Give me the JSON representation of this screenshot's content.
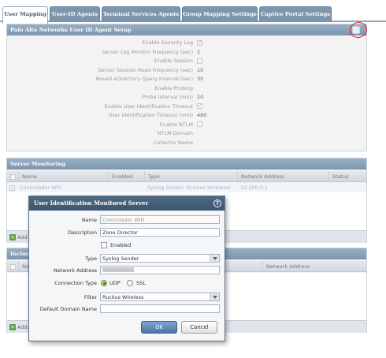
{
  "tabs": [
    {
      "label": "User Mapping"
    },
    {
      "label": "User-ID Agents"
    },
    {
      "label": "Terminal Services Agents"
    },
    {
      "label": "Group Mapping Settings"
    },
    {
      "label": "Captive Portal Settings"
    }
  ],
  "agent_setup": {
    "title": "Palo Alto Networks User ID Agent Setup",
    "rows": [
      {
        "label": "Enable Security Log",
        "value": "",
        "checkbox": true,
        "checked": true
      },
      {
        "label": "Server Log Monitor Frequency (sec)",
        "value": "2"
      },
      {
        "label": "Enable Session",
        "value": "",
        "checkbox": true,
        "checked": false
      },
      {
        "label": "Server Session Read Frequency (sec)",
        "value": "10"
      },
      {
        "label": "Novell eDirectory Query Interval (sec)",
        "value": "30"
      },
      {
        "label": "Enable Probing",
        "value": ""
      },
      {
        "label": "Probe Interval (min)",
        "value": "20"
      },
      {
        "label": "Enable User Identification Timeout",
        "value": "",
        "checkbox": true,
        "checked": true
      },
      {
        "label": "User Identification Timeout (min)",
        "value": "480"
      },
      {
        "label": "Enable NTLM",
        "value": "",
        "checkbox": true,
        "checked": false
      },
      {
        "label": "NTLM Domain",
        "value": ""
      },
      {
        "label": "Collector Name",
        "value": ""
      }
    ]
  },
  "server_monitoring": {
    "title": "Server Monitoring",
    "columns": [
      "Name",
      "Enabled",
      "Type",
      "Network Address",
      "Status"
    ],
    "row": {
      "name": "Controlador WiFi",
      "enabled": "",
      "type": "Syslog Sender (Ruckus Wireless)",
      "address": "10.200.0.1",
      "status": ""
    },
    "add_label": "Add"
  },
  "include_panel": {
    "title": "Includ",
    "columns": [
      "Nam",
      "Network Address"
    ],
    "add_label": "Add"
  },
  "dialog": {
    "title": "User Identification Monitored Server",
    "name_label": "Name",
    "name_value": "Controlador WiFi",
    "description_label": "Description",
    "description_value": "Zone Director",
    "enabled_label": "Enabled",
    "type_label": "Type",
    "type_value": "Syslog Sender",
    "network_address_label": "Network Address",
    "connection_type_label": "Connection Type",
    "udp_label": "UDP",
    "ssl_label": "SSL",
    "filter_label": "Filter",
    "filter_value": "Ruckus Wireless",
    "default_domain_label": "Default Domain Name",
    "default_domain_value": "",
    "ok_label": "OK",
    "cancel_label": "Cancel"
  },
  "colors": {
    "header_blue": "#7d96ae",
    "dialog_title": "#3d5670",
    "highlight_red": "#dd2222",
    "check_green": "#9fc58c"
  }
}
